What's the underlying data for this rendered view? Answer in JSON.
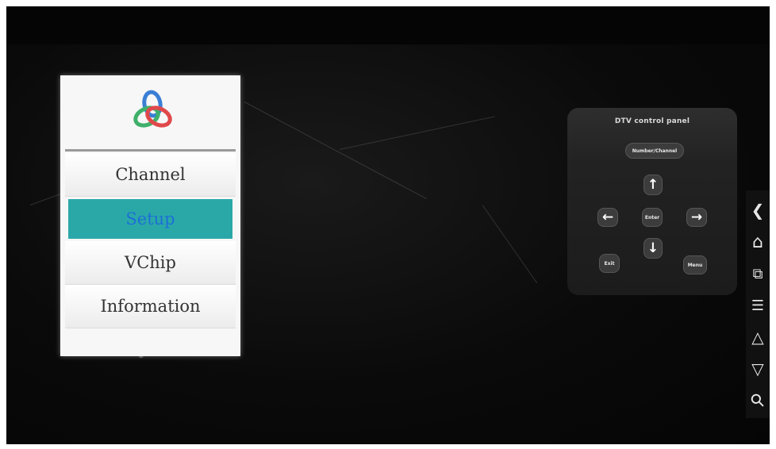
{
  "menu": {
    "items": [
      {
        "label": "Channel"
      },
      {
        "label": "Setup"
      },
      {
        "label": "VChip"
      },
      {
        "label": "Information"
      }
    ],
    "selected_index": 1,
    "selected_bg": "#2aa8a8",
    "selected_text": "#1d6fd6"
  },
  "dtv_panel": {
    "title": "DTV control panel",
    "number_button": "Number/Channel",
    "enter_label": "Enter",
    "exit_label": "Exit",
    "menu_label": "Menu",
    "up_icon": "↑",
    "down_icon": "↓",
    "left_icon": "←",
    "right_icon": "→"
  },
  "side_nav": {
    "back_icon": "❮",
    "home_icon": "⌂",
    "windows_icon": "⧉",
    "list_icon": "☰",
    "up_icon": "△",
    "down_icon": "▽",
    "search_icon": "⚲"
  },
  "logo": {
    "icon": "three-ring-logo",
    "colors": [
      "#3a7fd5",
      "#e0484a",
      "#3fb06a"
    ]
  }
}
